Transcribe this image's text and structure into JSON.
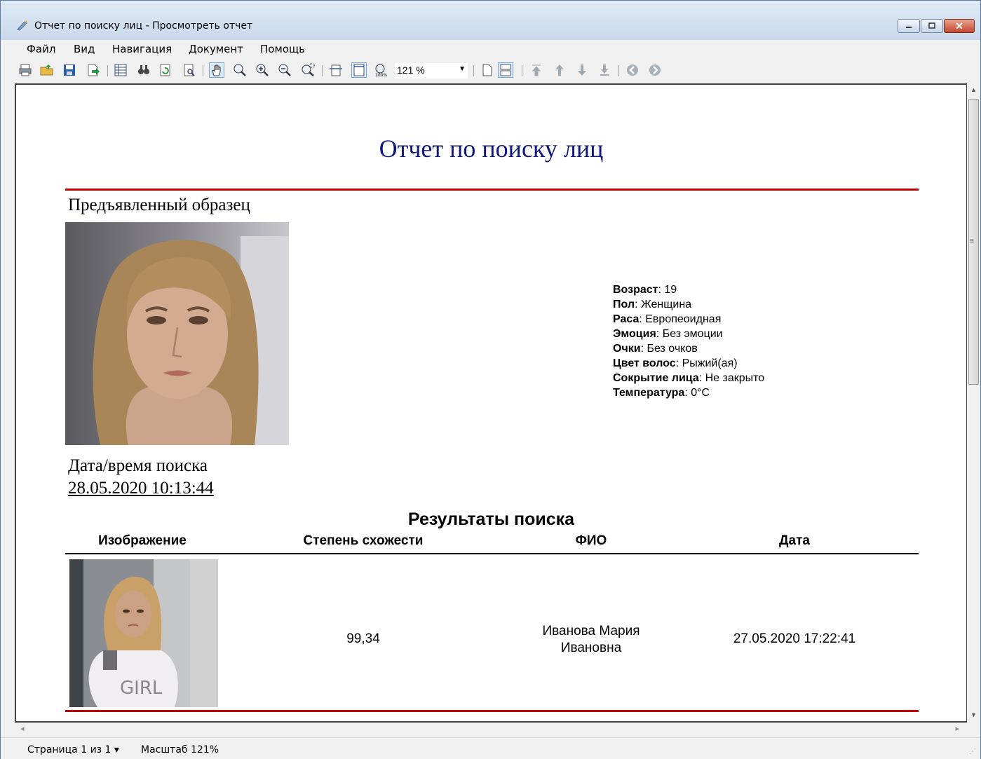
{
  "window": {
    "title": "Отчет по поиску лиц - Просмотреть отчет"
  },
  "menu": [
    "Файл",
    "Вид",
    "Навигация",
    "Документ",
    "Помощь"
  ],
  "toolbar": {
    "zoom_value": "121 %",
    "icons": [
      "print-icon",
      "open-icon",
      "save-icon",
      "export-icon",
      "table-icon",
      "find-icon",
      "refresh-icon",
      "preview-icon",
      "hand-icon",
      "zoom-icon",
      "zoom-in-icon",
      "zoom-out-icon",
      "zoom-region-icon",
      "page-width-icon",
      "whole-page-icon",
      "zoom-100-icon",
      "single-page-icon",
      "multi-page-icon",
      "first-page-icon",
      "prev-page-icon",
      "next-page-icon",
      "last-page-icon",
      "back-icon",
      "forward-icon"
    ]
  },
  "report": {
    "title": "Отчет по поиску лиц",
    "sample_label": "Предъявленный образец",
    "attributes": [
      {
        "label": "Возраст",
        "value": ": 19"
      },
      {
        "label": "Пол",
        "value": ": Женщина"
      },
      {
        "label": "Раса",
        "value": ": Европеоидная"
      },
      {
        "label": "Эмоция",
        "value": ": Без эмоции"
      },
      {
        "label": "Очки",
        "value": ": Без очков"
      },
      {
        "label": "Цвет волос",
        "value": ": Рыжий(ая)"
      },
      {
        "label": "Сокрытие лица",
        "value": ": Не закрыто"
      },
      {
        "label": "Температура",
        "value": ": 0°C"
      }
    ],
    "datetime_label": "Дата/время поиска",
    "datetime_value": "28.05.2020 10:13:44",
    "results_title": "Результаты поиска",
    "columns": [
      "Изображение",
      "Степень схожести",
      "ФИО",
      "Дата"
    ],
    "rows": [
      {
        "similarity": "99,34",
        "name_line1": "Иванова Мария",
        "name_line2": "Ивановна",
        "date": "27.05.2020 17:22:41",
        "shirt_text": "GIRL"
      }
    ]
  },
  "status": {
    "page": "Страница 1 из 1 ▾",
    "zoom": "Масштаб 121%"
  },
  "colors": {
    "report_title": "#10177a",
    "separator": "#c00000"
  }
}
